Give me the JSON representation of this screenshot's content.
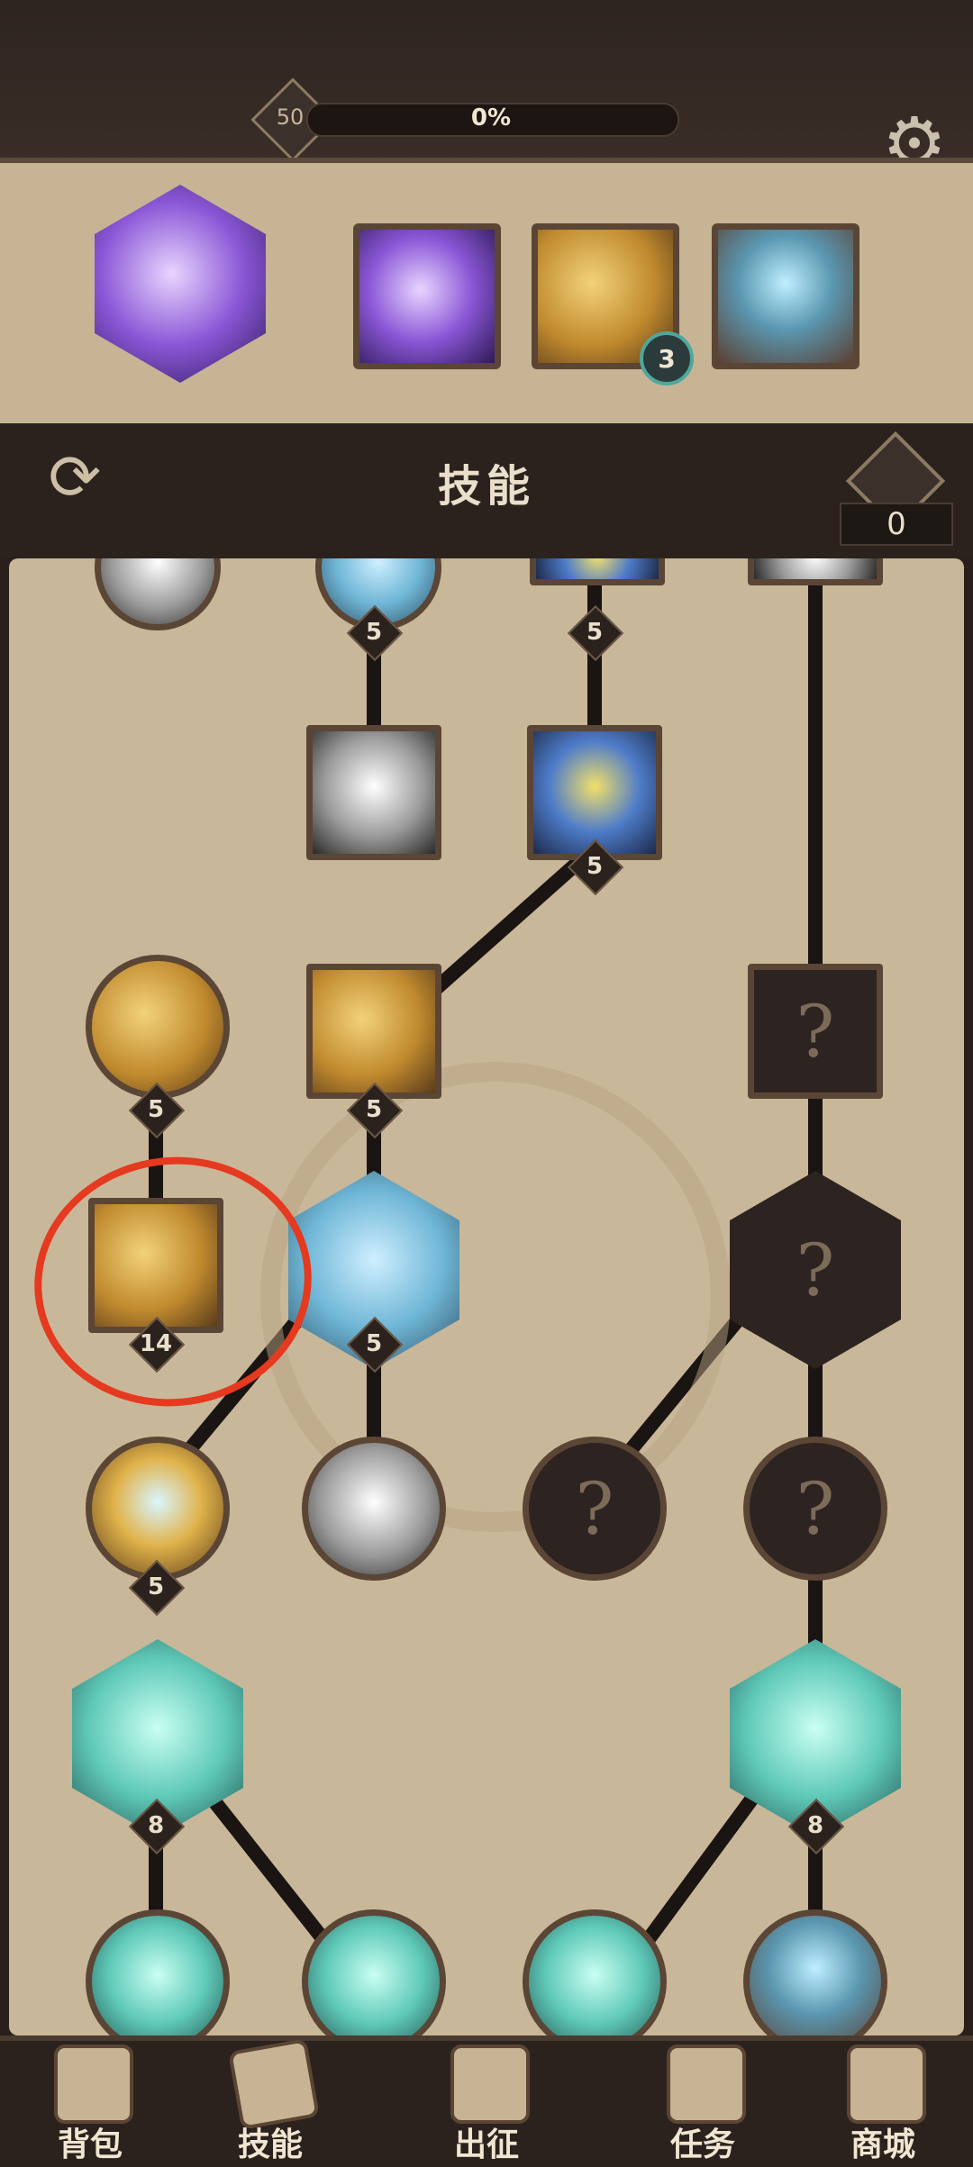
{
  "header": {
    "level": "50",
    "xp_percent_text": "0%",
    "xp_fraction": 0.0,
    "settings_icon": "gear-icon"
  },
  "equipped": [
    {
      "icon": "purple-shards-icon"
    },
    {
      "icon": "purple-slash-icon"
    },
    {
      "icon": "golden-dagger-icon",
      "count": "3"
    },
    {
      "icon": "ice-rock-icon"
    }
  ],
  "title": {
    "text": "技能",
    "swap_icon": "swap-arrows-icon"
  },
  "skill_points": {
    "value": "0",
    "icon": "diamond-icon"
  },
  "tree": {
    "top_partial_levels": [
      "5",
      "5"
    ],
    "nodes": [
      {
        "id": "ice-white",
        "level": null
      },
      {
        "id": "storm",
        "level": "5"
      },
      {
        "id": "gold-hands",
        "level": "5"
      },
      {
        "id": "gold-crystal",
        "level": "5"
      },
      {
        "id": "locked-square",
        "level": null
      },
      {
        "id": "gold-dagger",
        "level": "14"
      },
      {
        "id": "crystal-cluster",
        "level": "5"
      },
      {
        "id": "locked-hex",
        "level": null
      },
      {
        "id": "star-gold",
        "level": "5"
      },
      {
        "id": "silver-rock",
        "level": null
      },
      {
        "id": "locked-circle-1",
        "level": null
      },
      {
        "id": "locked-circle-2",
        "level": null
      },
      {
        "id": "teal-shield",
        "level": "8"
      },
      {
        "id": "teal-spikes",
        "level": "8"
      },
      {
        "id": "teal-whirl",
        "level": null
      },
      {
        "id": "teal-vortex",
        "level": null
      },
      {
        "id": "teal-figure",
        "level": null
      },
      {
        "id": "teal-rock",
        "level": null
      }
    ],
    "locked_symbol": "?"
  },
  "nav": [
    {
      "label": "背包",
      "icon": "backpack-icon"
    },
    {
      "label": "技能",
      "icon": "skill-book-icon"
    },
    {
      "label": "出征",
      "icon": "sword-map-icon"
    },
    {
      "label": "任务",
      "icon": "scroll-icon"
    },
    {
      "label": "商城",
      "icon": "shop-crown-icon"
    }
  ]
}
